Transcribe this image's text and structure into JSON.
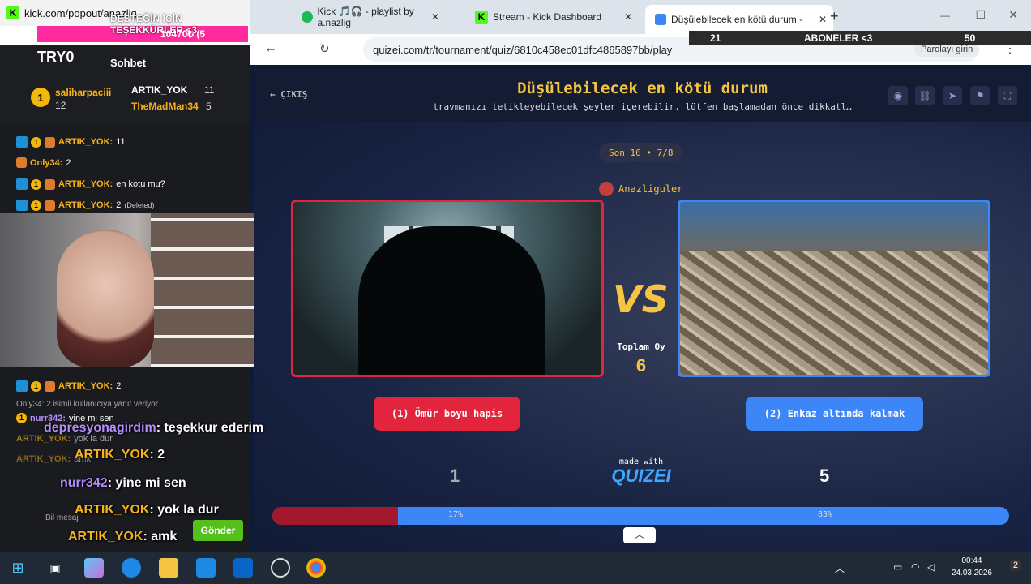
{
  "kick": {
    "window_title": "kick.com/popout/anazlig...",
    "try_label": "TRY0",
    "chat_title": "Sohbet",
    "leaderboard": [
      {
        "rank": "1",
        "name": "saliharpaciii",
        "count": "12"
      },
      {
        "name": "ARTIK_YOK",
        "count": "11"
      },
      {
        "name": "TheMadMan34",
        "count": "5"
      }
    ],
    "messages": [
      {
        "user": "ARTIK_YOK:",
        "text": "11"
      },
      {
        "user": "Only34:",
        "text": "2"
      },
      {
        "user": "ARTIK_YOK:",
        "text": "en kotu mu?"
      },
      {
        "user": "ARTIK_YOK:",
        "text": "2",
        "note": "(Deleted)"
      },
      {
        "user": "ARTIK_YOK:",
        "text": "2"
      },
      {
        "reply": "Only34: 2 isimli kullanıcıya yanıt veriyor"
      },
      {
        "user": "nurr342:",
        "text": "yine mi sen"
      },
      {
        "user": "ARTIK_YOK:",
        "text": "yok la dur"
      },
      {
        "user": "ARTIK_YOK:",
        "text": "amk"
      }
    ],
    "send_label": "Gönder",
    "input_placeholder": "Bil mesaj"
  },
  "overlays": {
    "sub_banner": "DESTEĞİN İÇİN TEŞEKKÜRLER <3",
    "sub_percent": "10470₺ (5",
    "sub_count_left": "21",
    "sub_title": "ABONELER <3",
    "sub_count_right": "50",
    "big_messages": [
      {
        "user": "depresyonagirdim",
        "text": ": teşekkur ederim"
      },
      {
        "user": "ARTIK_YOK",
        "text": ": 2"
      },
      {
        "user": "nurr342",
        "text": ": yine mi sen"
      },
      {
        "user": "ARTIK_YOK",
        "text": ": yok la dur"
      },
      {
        "user": "ARTIK_YOK",
        "text": ": amk"
      }
    ]
  },
  "browser": {
    "tabs": [
      {
        "label": "Kick 🎵🎧 - playlist by a.nazlig"
      },
      {
        "label": "Stream - Kick Dashboard"
      },
      {
        "label": "Düşülebilecek en kötü durum -"
      }
    ],
    "url": "quizei.com/tr/tournament/quiz/6810c458ec01dfc4865897bb/play",
    "profile_label": "Parolayı girin"
  },
  "quiz": {
    "exit_label": "ÇIKIŞ",
    "title": "Düşülebilecek en kötü durum",
    "subtitle": "travmanızı tetikleyebilecek şeyler içerebilir. lütfen başlamadan önce dikkatl…",
    "round": "Son 16 • 7/8",
    "author": "Anazliguler",
    "vs": "VS",
    "total_label": "Toplam Oy",
    "total_value": "6",
    "option1": {
      "label": "(1) Ömür boyu hapis",
      "votes": "1",
      "percent_label": "17%",
      "fraction": 0.17
    },
    "option2": {
      "label": "(2) Enkaz altında kalmak",
      "votes": "5",
      "percent_label": "83%",
      "fraction": 0.83
    },
    "made_with": "made with",
    "brand": "QUIZEI"
  },
  "taskbar": {
    "time": "00:44",
    "date": "24.03.2026",
    "notif_count": "2"
  },
  "colors": {
    "red": "#e2253d",
    "blue": "#3d86f7",
    "gold": "#f5c542",
    "kick_green": "#53fc18"
  }
}
